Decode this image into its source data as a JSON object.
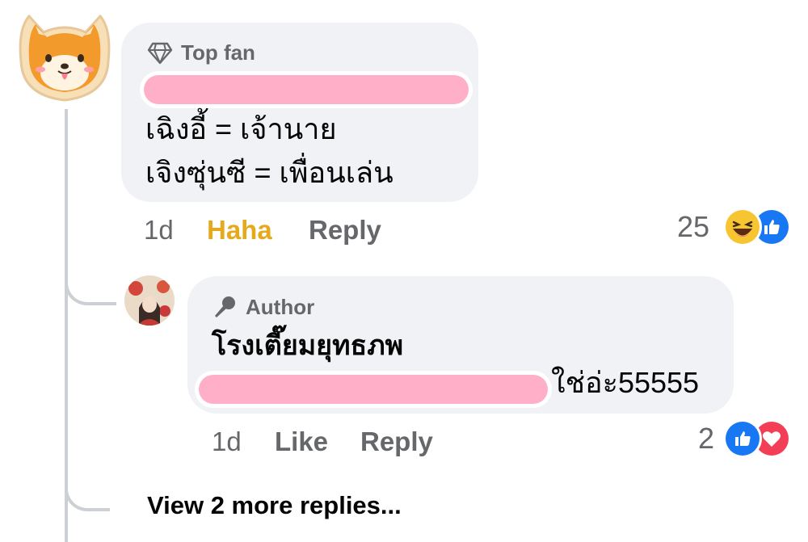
{
  "comment": {
    "badge_label": "Top fan",
    "line1": "เฉิงอี้ = เจ้านาย",
    "line2": "เจิงซุ่นซี = เพื่อนเล่น",
    "time": "1d",
    "reaction_button": "Haha",
    "reply_button": "Reply",
    "reaction_count": "25",
    "reaction_icons": [
      "haha-emoji-icon",
      "like-thumb-icon"
    ]
  },
  "reply": {
    "badge_label": "Author",
    "author_name": "โรงเตี๊ยมยุทธภพ",
    "text_suffix": "ใช่อ่ะ55555",
    "time": "1d",
    "like_button": "Like",
    "reply_button": "Reply",
    "reaction_count": "2",
    "reaction_icons": [
      "like-thumb-icon",
      "love-heart-icon"
    ]
  },
  "more_replies": "View 2 more replies...",
  "colors": {
    "bubble": "#f0f2f5",
    "haha_gold": "#e7a91c",
    "like_blue": "#1877f2",
    "love_red": "#f33e58",
    "redaction_pink": "#ffb0c8"
  }
}
